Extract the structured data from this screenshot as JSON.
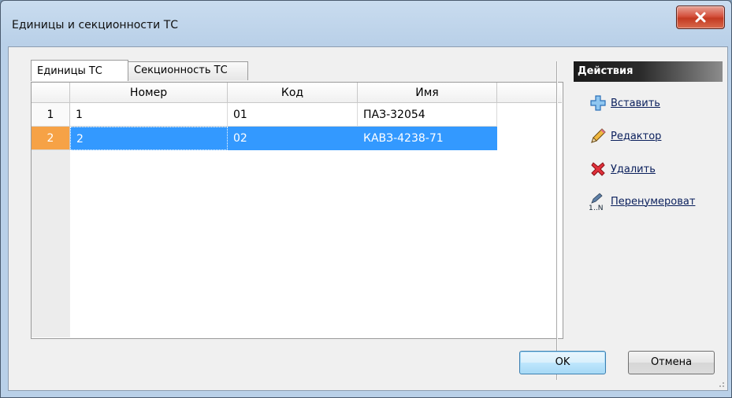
{
  "window": {
    "title": "Единицы и секционности ТС"
  },
  "tabs": [
    {
      "label": "Единицы ТС",
      "active": true
    },
    {
      "label": "Секционность ТС",
      "active": false
    }
  ],
  "table": {
    "columns": [
      "Номер",
      "Код",
      "Имя"
    ],
    "rows": [
      {
        "num": "1",
        "cells": [
          "1",
          "01",
          "ПАЗ-32054"
        ],
        "selected": false
      },
      {
        "num": "2",
        "cells": [
          "2",
          "02",
          "КАВЗ-4238-71"
        ],
        "selected": true
      }
    ]
  },
  "actions": {
    "header": "Действия",
    "items": [
      {
        "label": "Вставить",
        "icon": "plus-icon"
      },
      {
        "label": "Редактор",
        "icon": "pencil-icon"
      },
      {
        "label": "Удалить",
        "icon": "delete-x-icon"
      },
      {
        "label": "Перенумероват",
        "icon": "renumber-icon"
      }
    ]
  },
  "buttons": {
    "ok": "OK",
    "cancel": "Отмена"
  },
  "colors": {
    "selection": "#3399ff",
    "selected_rownum": "#f6a246",
    "close": "#c33b22"
  }
}
